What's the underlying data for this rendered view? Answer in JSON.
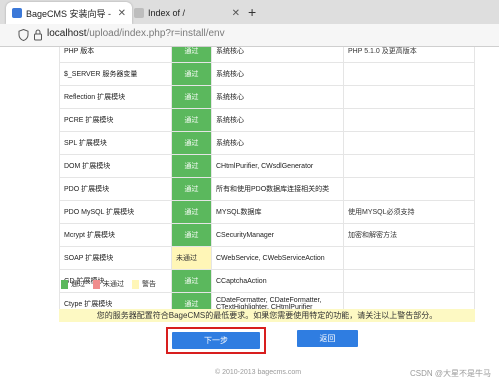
{
  "browser": {
    "tabs": [
      {
        "title": "BageCMS 安装向导 - 检测运行环境"
      },
      {
        "title": "Index of /"
      }
    ],
    "new_tab_symbol": "+",
    "close_symbol": "✕",
    "url_host": "localhost",
    "url_path": "/upload/index.php?r=install/env"
  },
  "rows": [
    {
      "name": "PHP 版本",
      "status": "通过",
      "used": "系统核心",
      "memo": "PHP 5.1.0 及更高版本"
    },
    {
      "name": "$_SERVER 服务器变量",
      "status": "通过",
      "used": "系统核心",
      "memo": ""
    },
    {
      "name": "Reflection 扩展模块",
      "status": "通过",
      "used": "系统核心",
      "memo": ""
    },
    {
      "name": "PCRE 扩展模块",
      "status": "通过",
      "used": "系统核心",
      "memo": ""
    },
    {
      "name": "SPL 扩展模块",
      "status": "通过",
      "used": "系统核心",
      "memo": ""
    },
    {
      "name": "DOM 扩展模块",
      "status": "通过",
      "used": "CHtmlPurifier, CWsdlGenerator",
      "memo": ""
    },
    {
      "name": "PDO 扩展模块",
      "status": "通过",
      "used": "所有和使用PDO数据库连接相关的类",
      "memo": ""
    },
    {
      "name": "PDO MySQL 扩展模块",
      "status": "通过",
      "used": "MYSQL数据库",
      "memo": "使用MYSQL必须支持"
    },
    {
      "name": "Mcrypt 扩展模块",
      "status": "通过",
      "used": "CSecurityManager",
      "memo": "加密和解密方法"
    },
    {
      "name": "SOAP 扩展模块",
      "status": "未通过",
      "used": "CWebService, CWebServiceAction",
      "memo": ""
    },
    {
      "name": "GD 扩展模块",
      "status": "通过",
      "used": "CCaptchaAction",
      "memo": ""
    },
    {
      "name": "Ctype 扩展模块",
      "status": "通过",
      "used": "CDateFormatter, CDateFormatter, CTextHighlighter, CHtmlPurifier",
      "memo": ""
    }
  ],
  "legend": [
    {
      "label": "通过",
      "color": "#5bb85d"
    },
    {
      "label": "未通过",
      "color": "#f08c8c"
    },
    {
      "label": "警告",
      "color": "#fff6b7"
    }
  ],
  "notice": "您的服务器配置符合BageCMS的最低要求。如果您需要使用特定的功能，请关注以上警告部分。",
  "buttons": {
    "next": "下一步",
    "back": "返回"
  },
  "footer": "© 2010-2013 bagecms.com",
  "watermark": "CSDN @大星不是牛马",
  "colors": {
    "pass": "#5bb85d",
    "warn": "#fff6b7",
    "primary_button": "#2f7de1",
    "highlight_border": "#d81e1e"
  }
}
